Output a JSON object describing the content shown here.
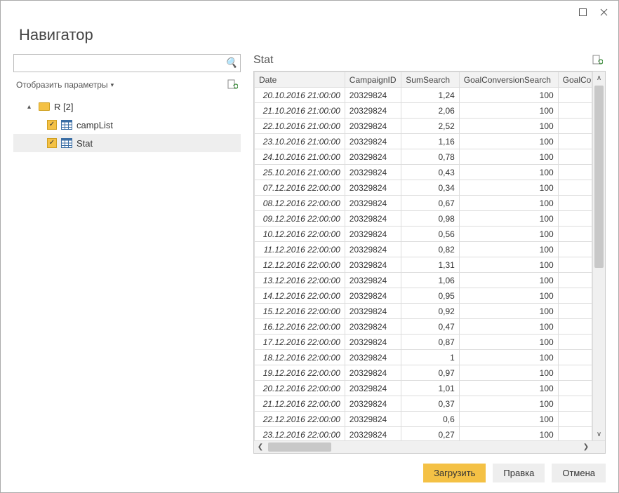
{
  "window": {
    "title": "Навигатор"
  },
  "left": {
    "search_placeholder": "",
    "params_label": "Отобразить параметры",
    "tree": {
      "root_label": "R [2]",
      "items": [
        {
          "label": "campList",
          "checked": true
        },
        {
          "label": "Stat",
          "checked": true,
          "selected": true
        }
      ]
    }
  },
  "preview": {
    "title": "Stat",
    "columns": [
      "Date",
      "CampaignID",
      "SumSearch",
      "GoalConversionSearch",
      "GoalCo"
    ],
    "rows": [
      {
        "date": "20.10.2016 21:00:00",
        "camp": "20329824",
        "sum": "1,24",
        "goal": "100"
      },
      {
        "date": "21.10.2016 21:00:00",
        "camp": "20329824",
        "sum": "2,06",
        "goal": "100"
      },
      {
        "date": "22.10.2016 21:00:00",
        "camp": "20329824",
        "sum": "2,52",
        "goal": "100"
      },
      {
        "date": "23.10.2016 21:00:00",
        "camp": "20329824",
        "sum": "1,16",
        "goal": "100"
      },
      {
        "date": "24.10.2016 21:00:00",
        "camp": "20329824",
        "sum": "0,78",
        "goal": "100"
      },
      {
        "date": "25.10.2016 21:00:00",
        "camp": "20329824",
        "sum": "0,43",
        "goal": "100"
      },
      {
        "date": "07.12.2016 22:00:00",
        "camp": "20329824",
        "sum": "0,34",
        "goal": "100"
      },
      {
        "date": "08.12.2016 22:00:00",
        "camp": "20329824",
        "sum": "0,67",
        "goal": "100"
      },
      {
        "date": "09.12.2016 22:00:00",
        "camp": "20329824",
        "sum": "0,98",
        "goal": "100"
      },
      {
        "date": "10.12.2016 22:00:00",
        "camp": "20329824",
        "sum": "0,56",
        "goal": "100"
      },
      {
        "date": "11.12.2016 22:00:00",
        "camp": "20329824",
        "sum": "0,82",
        "goal": "100"
      },
      {
        "date": "12.12.2016 22:00:00",
        "camp": "20329824",
        "sum": "1,31",
        "goal": "100"
      },
      {
        "date": "13.12.2016 22:00:00",
        "camp": "20329824",
        "sum": "1,06",
        "goal": "100"
      },
      {
        "date": "14.12.2016 22:00:00",
        "camp": "20329824",
        "sum": "0,95",
        "goal": "100"
      },
      {
        "date": "15.12.2016 22:00:00",
        "camp": "20329824",
        "sum": "0,92",
        "goal": "100"
      },
      {
        "date": "16.12.2016 22:00:00",
        "camp": "20329824",
        "sum": "0,47",
        "goal": "100"
      },
      {
        "date": "17.12.2016 22:00:00",
        "camp": "20329824",
        "sum": "0,87",
        "goal": "100"
      },
      {
        "date": "18.12.2016 22:00:00",
        "camp": "20329824",
        "sum": "1",
        "goal": "100"
      },
      {
        "date": "19.12.2016 22:00:00",
        "camp": "20329824",
        "sum": "0,97",
        "goal": "100"
      },
      {
        "date": "20.12.2016 22:00:00",
        "camp": "20329824",
        "sum": "1,01",
        "goal": "100"
      },
      {
        "date": "21.12.2016 22:00:00",
        "camp": "20329824",
        "sum": "0,37",
        "goal": "100"
      },
      {
        "date": "22.12.2016 22:00:00",
        "camp": "20329824",
        "sum": "0,6",
        "goal": "100"
      },
      {
        "date": "23.12.2016 22:00:00",
        "camp": "20329824",
        "sum": "0,27",
        "goal": "100"
      }
    ]
  },
  "footer": {
    "load": "Загрузить",
    "edit": "Правка",
    "cancel": "Отмена"
  }
}
